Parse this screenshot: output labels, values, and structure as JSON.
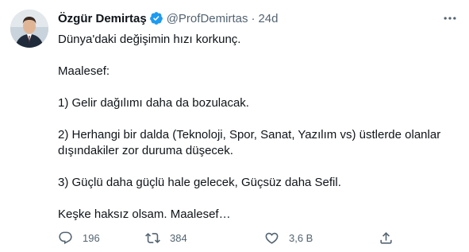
{
  "tweet": {
    "author_name": "Özgür Demirtaş",
    "handle": "@ProfDemirtas",
    "separator": "·",
    "time": "24d",
    "paragraphs": [
      [
        "Dünya'daki değişimin hızı korkunç."
      ],
      [
        "Maalesef:"
      ],
      [
        "1) Gelir dağılımı daha da bozulacak."
      ],
      [
        "2) Herhangi bir dalda (Teknoloji, Spor, Sanat, Yazılım vs) üstlerde olanlar",
        "dışındakiler zor duruma düşecek."
      ],
      [
        "3) Güçlü daha güçlü hale gelecek, Güçsüz daha Sefil."
      ],
      [
        "Keşke haksız olsam. Maalesef…"
      ]
    ]
  },
  "actions": {
    "reply": {
      "icon": "reply-icon",
      "count": "196"
    },
    "retweet": {
      "icon": "retweet-icon",
      "count": "384"
    },
    "like": {
      "icon": "heart-icon",
      "count": "3,6 B"
    },
    "share": {
      "icon": "share-icon"
    }
  },
  "colors": {
    "text_primary": "#0f1419",
    "text_secondary": "#536471",
    "verified_badge": "#1d9bf0",
    "background": "#ffffff"
  }
}
